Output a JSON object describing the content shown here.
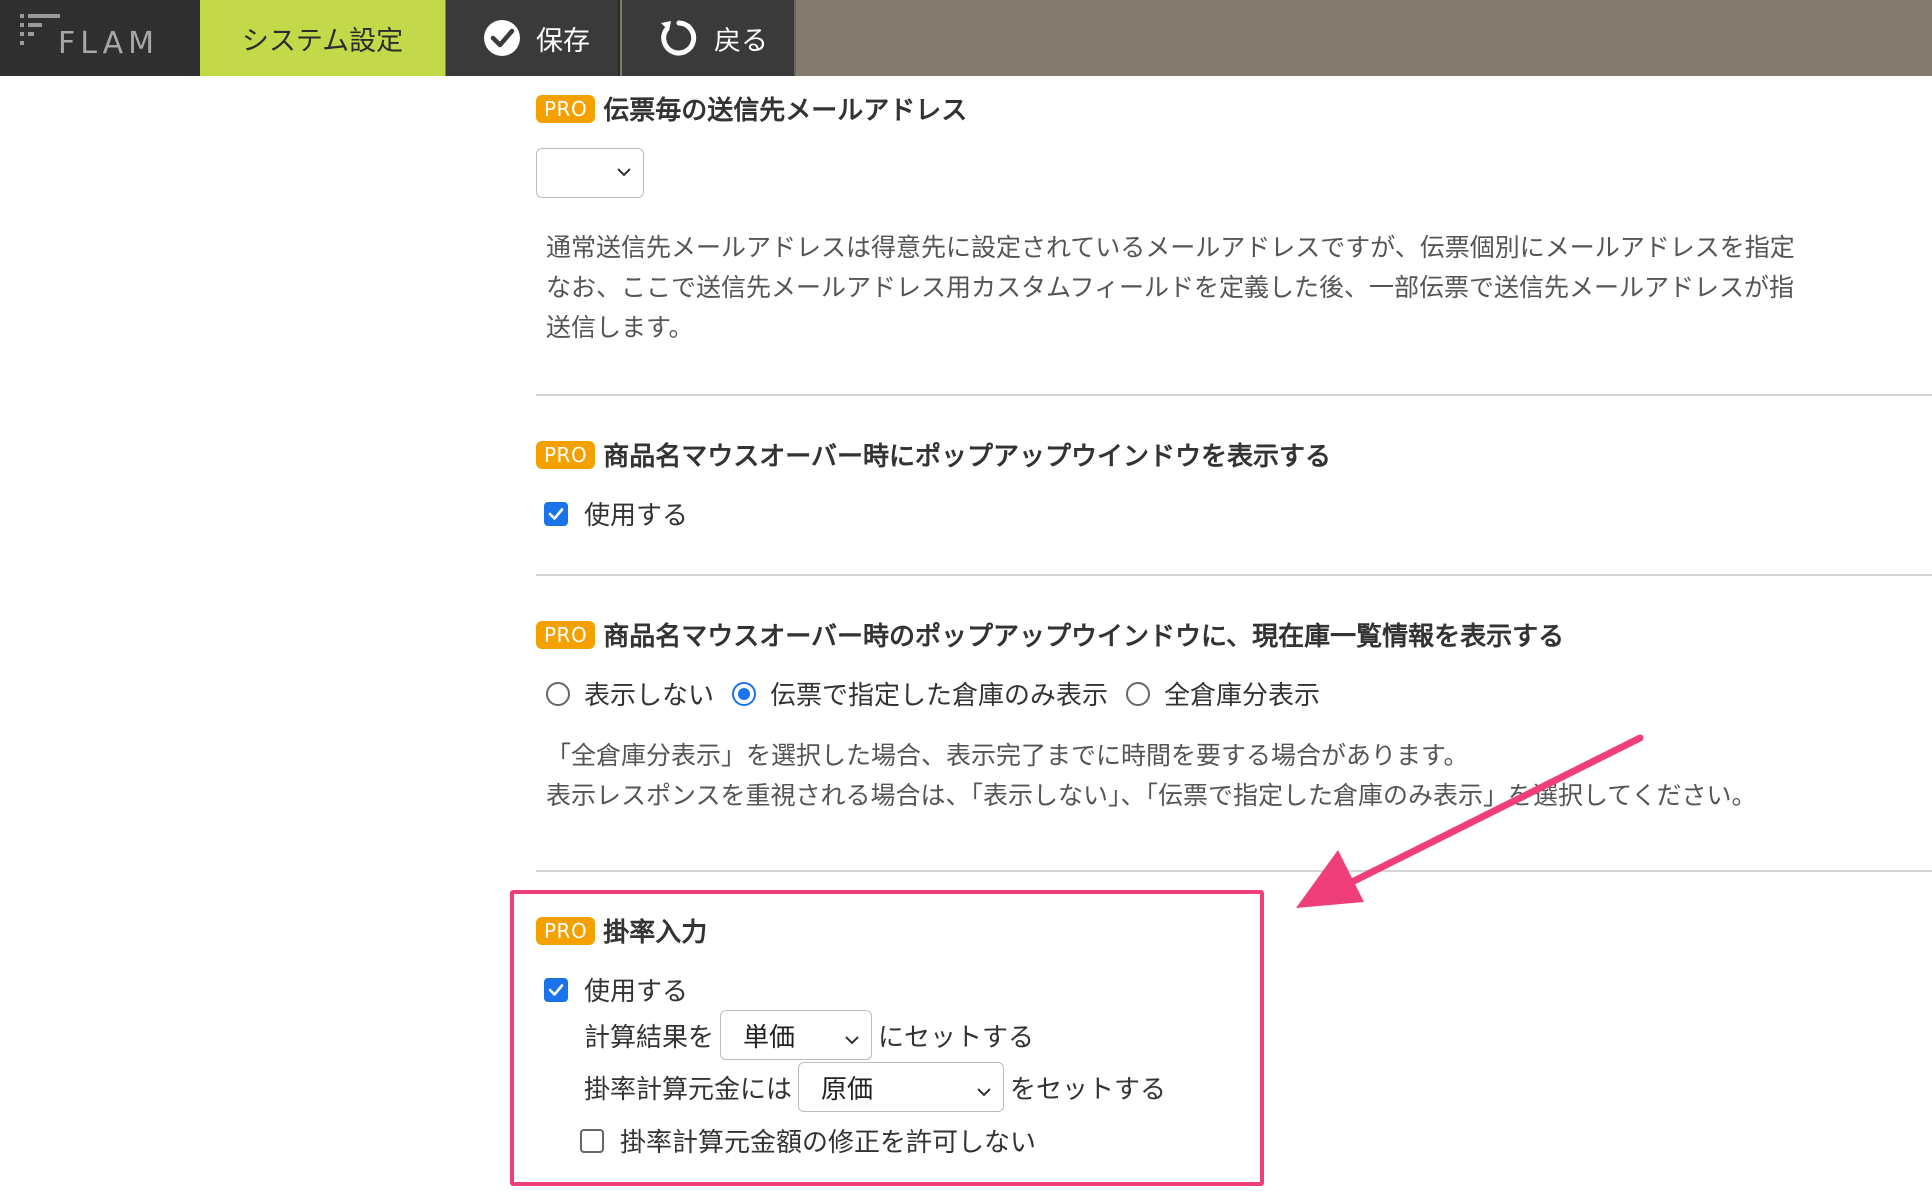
{
  "toolbar": {
    "logo_text": "FLAM",
    "tab_title": "システム設定",
    "save_label": "保存",
    "back_label": "戻る"
  },
  "sections": {
    "email": {
      "badge": "PRO",
      "title": "伝票毎の送信先メールアドレス",
      "select_value": "",
      "desc_line1": "通常送信先メールアドレスは得意先に設定されているメールアドレスですが、伝票個別にメールアドレスを指定",
      "desc_line2": "なお、ここで送信先メールアドレス用カスタムフィールドを定義した後、一部伝票で送信先メールアドレスが指",
      "desc_line3": "送信します。"
    },
    "popup": {
      "badge": "PRO",
      "title": "商品名マウスオーバー時にポップアップウインドウを表示する",
      "checkbox_label": "使用する",
      "checked": true
    },
    "stock": {
      "badge": "PRO",
      "title": "商品名マウスオーバー時のポップアップウインドウに、現在庫一覧情報を表示する",
      "options": [
        "表示しない",
        "伝票で指定した倉庫のみ表示",
        "全倉庫分表示"
      ],
      "selected_index": 1,
      "desc_line1": "「全倉庫分表示」を選択した場合、表示完了までに時間を要する場合があります。",
      "desc_line2": "表示レスポンスを重視される場合は、「表示しない」、「伝票で指定した倉庫のみ表示」を選択してください。"
    },
    "rate": {
      "badge": "PRO",
      "title": "掛率入力",
      "checkbox_label": "使用する",
      "checked": true,
      "calc_prefix": "計算結果を",
      "calc_select": "単価",
      "calc_suffix": "にセットする",
      "base_prefix": "掛率計算元金には",
      "base_select": "原価",
      "base_suffix": "をセットする",
      "no_edit_label": "掛率計算元金額の修正を許可しない",
      "no_edit_checked": false
    }
  },
  "colors": {
    "accent_tab": "#c3d94a",
    "pro_badge": "#f4a100",
    "highlight": "#ef3f7a",
    "checkbox": "#1a73e8"
  }
}
